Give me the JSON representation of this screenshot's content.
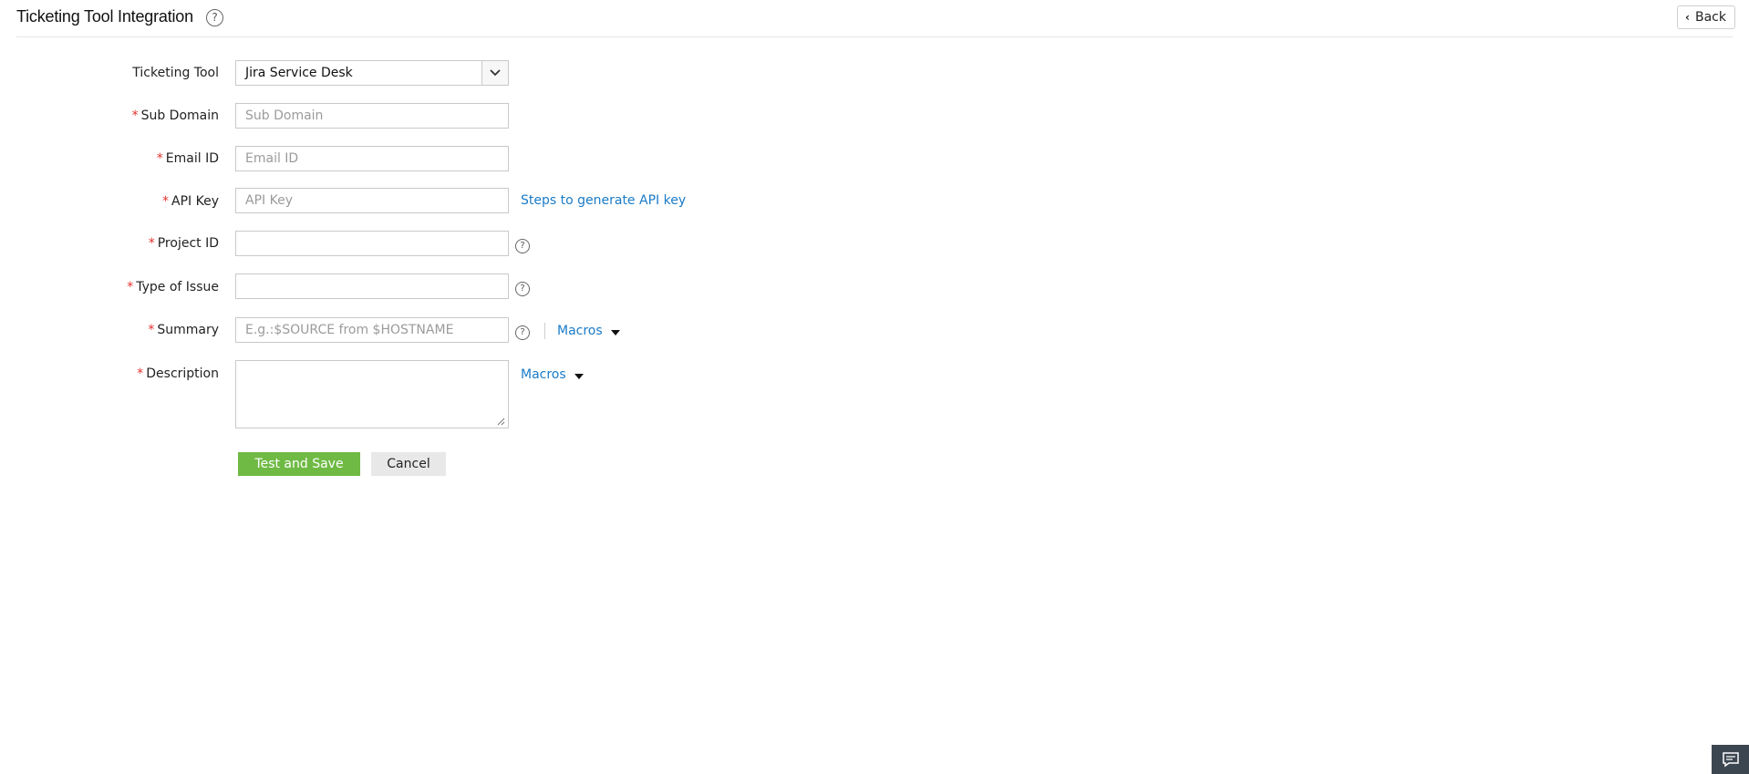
{
  "header": {
    "title": "Ticketing Tool Integration",
    "help_glyph": "?",
    "back_label": "Back"
  },
  "form": {
    "required_marker": "*",
    "help_glyph": "?",
    "ticketing_tool": {
      "label": "Ticketing Tool",
      "selected": "Jira Service Desk"
    },
    "sub_domain": {
      "label": "Sub Domain",
      "placeholder": "Sub Domain",
      "value": ""
    },
    "email_id": {
      "label": "Email ID",
      "placeholder": "Email ID",
      "value": ""
    },
    "api_key": {
      "label": "API Key",
      "placeholder": "API Key",
      "value": "",
      "link_label": "Steps to generate API key"
    },
    "project_id": {
      "label": "Project ID",
      "value": ""
    },
    "type_of_issue": {
      "label": "Type of Issue",
      "value": ""
    },
    "summary": {
      "label": "Summary",
      "placeholder": "E.g.:$SOURCE from $HOSTNAME",
      "value": "",
      "macros_label": "Macros"
    },
    "description": {
      "label": "Description",
      "value": "",
      "macros_label": "Macros"
    }
  },
  "actions": {
    "test_and_save": "Test and Save",
    "cancel": "Cancel"
  },
  "colors": {
    "primary_button": "#6fba44",
    "link": "#1a7bc7",
    "required": "#e0312d",
    "chat_button": "#3b4650"
  },
  "icons": [
    "help-icon",
    "chevron-left-icon",
    "chevron-down-icon",
    "caret-down-icon",
    "chat-icon"
  ]
}
